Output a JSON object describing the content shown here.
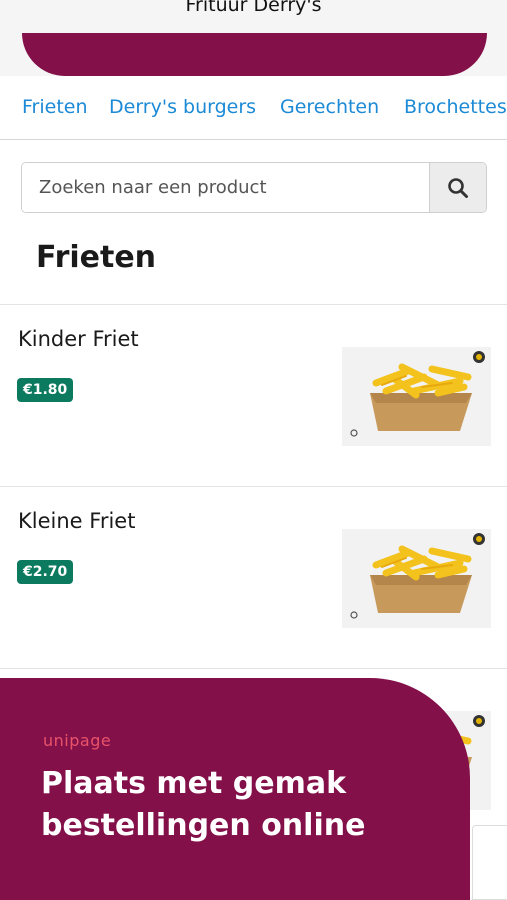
{
  "header": {
    "title": "Frituur Derry's"
  },
  "categories": [
    {
      "label": "Frieten"
    },
    {
      "label": "Derry's burgers"
    },
    {
      "label": "Gerechten"
    },
    {
      "label": "Brochettes"
    }
  ],
  "search": {
    "placeholder": "Zoeken naar een product",
    "icon": "search-icon"
  },
  "section": {
    "title": "Frieten"
  },
  "products": [
    {
      "name": "Kinder Friet",
      "price": "€1.80"
    },
    {
      "name": "Kleine Friet",
      "price": "€2.70"
    },
    {
      "name": "",
      "price": ""
    }
  ],
  "promo": {
    "brand": "unipage",
    "text": "Plaats met gemak bestellingen online"
  },
  "colors": {
    "brand": "#831049",
    "link": "#1c8ad6",
    "price_badge": "#0b7a5e",
    "promo_brand": "#e8536a"
  }
}
